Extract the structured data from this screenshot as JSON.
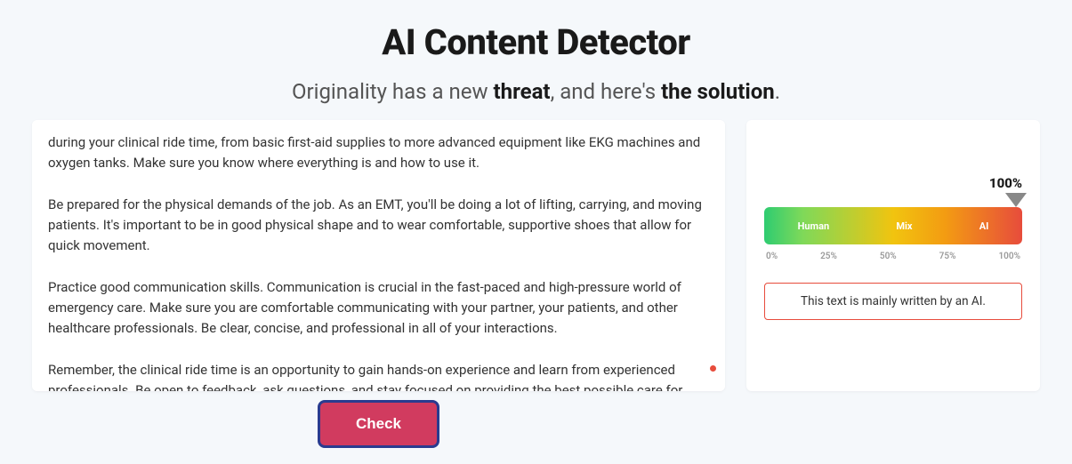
{
  "header": {
    "title": "AI Content Detector",
    "subtitle_prefix": "Originality has a new ",
    "subtitle_bold1": "threat",
    "subtitle_mid": ", and here's ",
    "subtitle_bold2": "the solution",
    "subtitle_suffix": "."
  },
  "input": {
    "text": "during your clinical ride time, from basic first-aid supplies to more advanced equipment like EKG machines and oxygen tanks. Make sure you know where everything is and how to use it.\n\nBe prepared for the physical demands of the job. As an EMT, you'll be doing a lot of lifting, carrying, and moving patients. It's important to be in good physical shape and to wear comfortable, supportive shoes that allow for quick movement.\n\nPractice good communication skills. Communication is crucial in the fast-paced and high-pressure world of emergency care. Make sure you are comfortable communicating with your partner, your patients, and other healthcare professionals. Be clear, concise, and professional in all of your interactions.\n\nRemember, the clinical ride time is an opportunity to gain hands-on experience and learn from experienced professionals. Be open to feedback, ask questions, and stay focused on providing the best possible care for your patients. Good luck!"
  },
  "actions": {
    "check_label": "Check"
  },
  "results": {
    "percentage": "100%",
    "gauge": {
      "human_label": "Human",
      "mix_label": "Mix",
      "ai_label": "AI",
      "ticks": [
        "0%",
        "25%",
        "50%",
        "75%",
        "100%"
      ]
    },
    "verdict": "This text is mainly written by an AI."
  }
}
